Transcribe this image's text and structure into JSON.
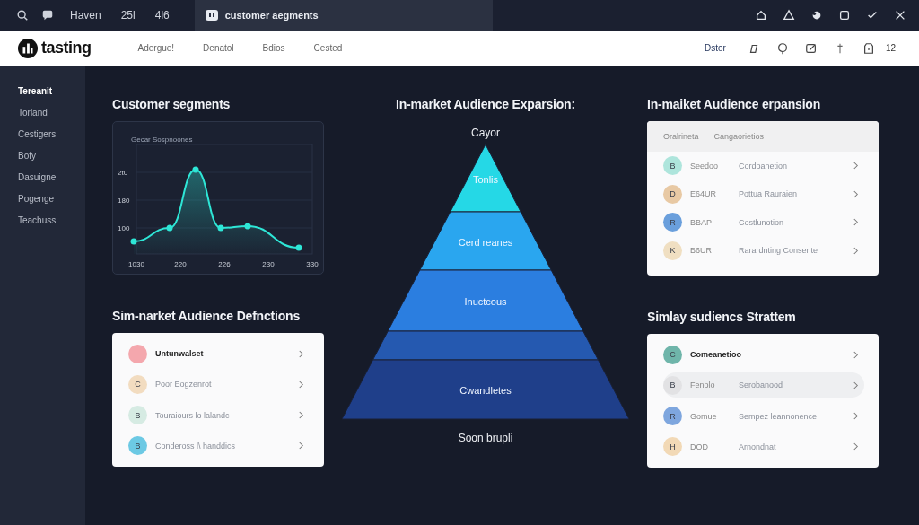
{
  "titlebar": {
    "items": [
      "Haven",
      "25l",
      "4l6"
    ],
    "tab": {
      "label": "customer aegments",
      "selected": true
    }
  },
  "header": {
    "brand": "tasting",
    "nav": [
      "Adergue!",
      "Denatol",
      "Bdios",
      "Cested"
    ],
    "user": "Dstor",
    "count": "12"
  },
  "sidebar": {
    "items": [
      {
        "label": "Tereanit",
        "selected": true
      },
      {
        "label": "Torland",
        "selected": false
      },
      {
        "label": "Cestigers",
        "selected": false
      },
      {
        "label": "Bofy",
        "selected": false
      },
      {
        "label": "Dasuigne",
        "selected": false
      },
      {
        "label": "Pogenge",
        "selected": false
      },
      {
        "label": "Teachuss",
        "selected": false
      }
    ]
  },
  "segments": {
    "title": "Customer segments",
    "chart": {
      "title": "Gecar Sospnoones",
      "y_labels": [
        "2t0",
        "180",
        "100"
      ],
      "x_labels": [
        "1030",
        "220",
        "226",
        "230",
        "330"
      ]
    }
  },
  "pyramid": {
    "title": "In-market Audience Exparsion:",
    "top_label": "Cayor",
    "bottom_label": "Soon brupli",
    "layers": [
      {
        "label": "Tonlis",
        "color": "#25d8e6"
      },
      {
        "label": "Cerd reanes",
        "color": "#2aa6ef"
      },
      {
        "label": "Inuctcous",
        "color": "#2b7ee0"
      },
      {
        "color": "#2559b0"
      },
      {
        "label": "Cwandletes",
        "color": "#1f3f8a"
      }
    ]
  },
  "definitions": {
    "title": "Sim-narket Audience Defnctions",
    "items": [
      {
        "initial": "–",
        "text": "Untunwalset",
        "color": "#f4a7ad",
        "emphasized": true
      },
      {
        "initial": "C",
        "text": "Poor Eogzenrot",
        "color": "#f2dcc0",
        "emphasized": false
      },
      {
        "initial": "B",
        "text": "Touraiours lo lalandc",
        "color": "#d6ebe3",
        "emphasized": false
      },
      {
        "initial": "B",
        "text": "Condeross l\\ handdics",
        "color": "#6cc9e4",
        "emphasized": false
      }
    ]
  },
  "expansion": {
    "title": "In-maiket Audience erpansion",
    "columns": [
      "Oralrineta",
      "Cangaorietios"
    ],
    "rows": [
      {
        "initial": "B",
        "name": "Seedoo",
        "detail": "Cordoanetion",
        "color": "#aee5dc"
      },
      {
        "initial": "D",
        "name": "E64UR",
        "detail": "Pottua Rauraien",
        "color": "#e8c9a4"
      },
      {
        "initial": "R",
        "name": "BBAP",
        "detail": "Costlunotion",
        "color": "#6a9fdc"
      },
      {
        "initial": "K",
        "name": "B6UR",
        "detail": "Rarardnting Consente",
        "color": "#f0dfc2"
      }
    ]
  },
  "strategy": {
    "title": "Simlay sudiencs Strattem",
    "items": [
      {
        "initial": "C",
        "name": "Comeanetioo",
        "color": "#6fb5aa",
        "emphasized": true,
        "selected": false
      },
      {
        "initial": "B",
        "name": "Fenolo",
        "detail": "Serobanood",
        "color": "#e2e2e4",
        "emphasized": false,
        "selected": true
      },
      {
        "initial": "R",
        "name": "Gomue",
        "detail": "Sempez leannonence",
        "color": "#7ea6de",
        "emphasized": false,
        "selected": false
      },
      {
        "initial": "H",
        "name": "DOD",
        "detail": "Arnondnat",
        "color": "#f2d9b6",
        "emphasized": false,
        "selected": false
      }
    ]
  }
}
